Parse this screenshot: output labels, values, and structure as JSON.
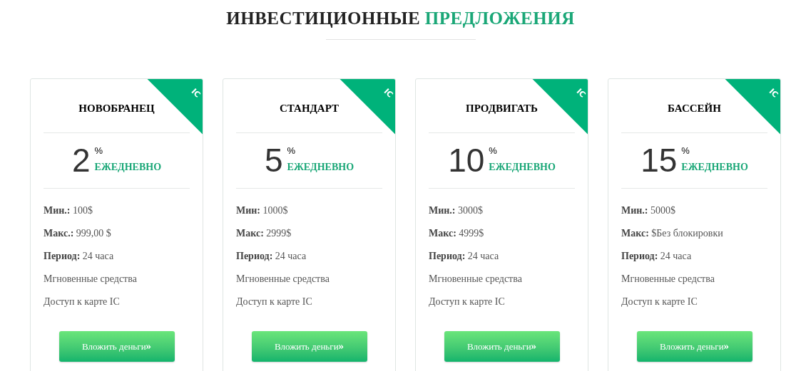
{
  "heading": {
    "dark": "ИНВЕСТИЦИОННЫЕ",
    "accent": "ПРЕДЛОЖЕНИЯ"
  },
  "plans": [
    {
      "corner": "IC",
      "name": "НОВОБРАНЕЦ",
      "rate": "2",
      "unit": "%",
      "period": "ЕЖЕДНЕВНО",
      "features": [
        {
          "label": "Мин.:",
          "value": "100$"
        },
        {
          "label": "Макс.:",
          "value": "999,00 $"
        },
        {
          "label": "Период:",
          "value": "24 часа"
        },
        {
          "value": "Мгновенные средства"
        },
        {
          "value": "Доступ к карте IC"
        }
      ],
      "button": "Вложить деньги",
      "button_icon": "»"
    },
    {
      "corner": "IC",
      "name": "СТАНДАРТ",
      "rate": "5",
      "unit": "%",
      "period": "ЕЖЕДНЕВНО",
      "features": [
        {
          "label": "Мин:",
          "value": "1000$"
        },
        {
          "label": "Макс:",
          "value": "2999$"
        },
        {
          "label": "Период:",
          "value": "24 часа"
        },
        {
          "value": "Мгновенные средства"
        },
        {
          "value": "Доступ к карте IC"
        }
      ],
      "button": "Вложить деньги",
      "button_icon": "»"
    },
    {
      "corner": "IC",
      "name": "ПРОДВИГАТЬ",
      "rate": "10",
      "unit": "%",
      "period": "ЕЖЕДНЕВНО",
      "features": [
        {
          "label": "Мин.:",
          "value": "3000$"
        },
        {
          "label": "Макс:",
          "value": "4999$"
        },
        {
          "label": "Период:",
          "value": "24 часа"
        },
        {
          "value": "Мгновенные средства"
        },
        {
          "value": "Доступ к карте IC"
        }
      ],
      "button": "Вложить деньги",
      "button_icon": "»"
    },
    {
      "corner": "IC",
      "name": "БАССЕЙН",
      "rate": "15",
      "unit": "%",
      "period": "ЕЖЕДНЕВНО",
      "features": [
        {
          "label": "Мин.:",
          "value": "5000$"
        },
        {
          "label": "Макс:",
          "value": "$Без блокировки"
        },
        {
          "label": "Период:",
          "value": "24 часа"
        },
        {
          "value": "Мгновенные средства"
        },
        {
          "value": "Доступ к карте IC"
        }
      ],
      "button": "Вложить деньги",
      "button_icon": "»"
    }
  ]
}
